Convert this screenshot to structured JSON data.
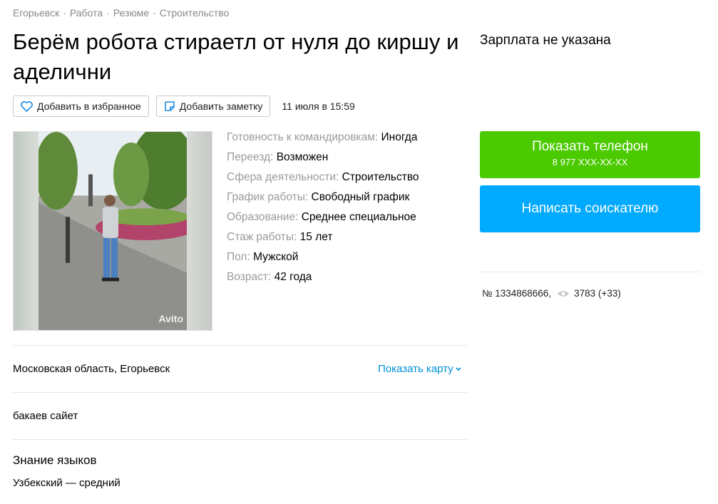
{
  "breadcrumb": [
    "Егорьевск",
    "Работа",
    "Резюме",
    "Строительство"
  ],
  "title": "Берём робота стираетл от нуля до киршу и аделични",
  "actions": {
    "favorite_label": "Добавить в избранное",
    "note_label": "Добавить заметку",
    "date": "11 июля в 15:59"
  },
  "photo": {
    "watermark": "Avito"
  },
  "params": [
    {
      "label": "Готовность к командировкам:",
      "value": "Иногда"
    },
    {
      "label": "Переезд:",
      "value": "Возможен"
    },
    {
      "label": "Сфера деятельности:",
      "value": "Строительство"
    },
    {
      "label": "График работы:",
      "value": "Свободный график"
    },
    {
      "label": "Образование:",
      "value": "Среднее специальное"
    },
    {
      "label": "Стаж работы:",
      "value": "15 лет"
    },
    {
      "label": "Пол:",
      "value": "Мужской"
    },
    {
      "label": "Возраст:",
      "value": "42 года"
    }
  ],
  "location": {
    "address": "Московская область, Егорьевск",
    "show_map": "Показать карту"
  },
  "description": "бакаев сайет",
  "languages": {
    "heading": "Знание языков",
    "value": "Узбекский — средний"
  },
  "sidebar": {
    "salary": "Зарплата не указана",
    "phone_button": "Показать телефон",
    "phone_masked": "8 977 XXX-XX-XX",
    "message_button": "Написать соискателю",
    "item_number": "№ 1334868666,",
    "views": "3783 (+33)"
  },
  "colors": {
    "green": "#4bca00",
    "blue": "#00aaff",
    "link": "#0091d9"
  }
}
